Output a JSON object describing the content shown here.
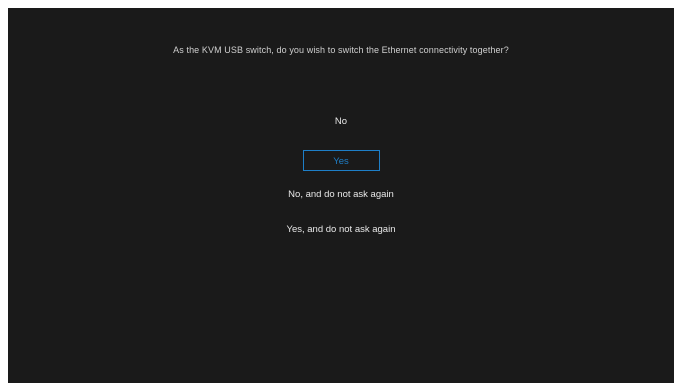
{
  "dialog": {
    "question": "As the KVM USB switch, do you wish to switch the Ethernet connectivity together?",
    "options": [
      {
        "label": "No",
        "selected": false
      },
      {
        "label": "Yes",
        "selected": true
      },
      {
        "label": "No, and do not ask again",
        "selected": false
      },
      {
        "label": "Yes, and do not ask again",
        "selected": false
      }
    ]
  },
  "colors": {
    "background": "#1a1a1a",
    "text": "#e8e8e8",
    "selected_accent": "#1e7fc8"
  }
}
